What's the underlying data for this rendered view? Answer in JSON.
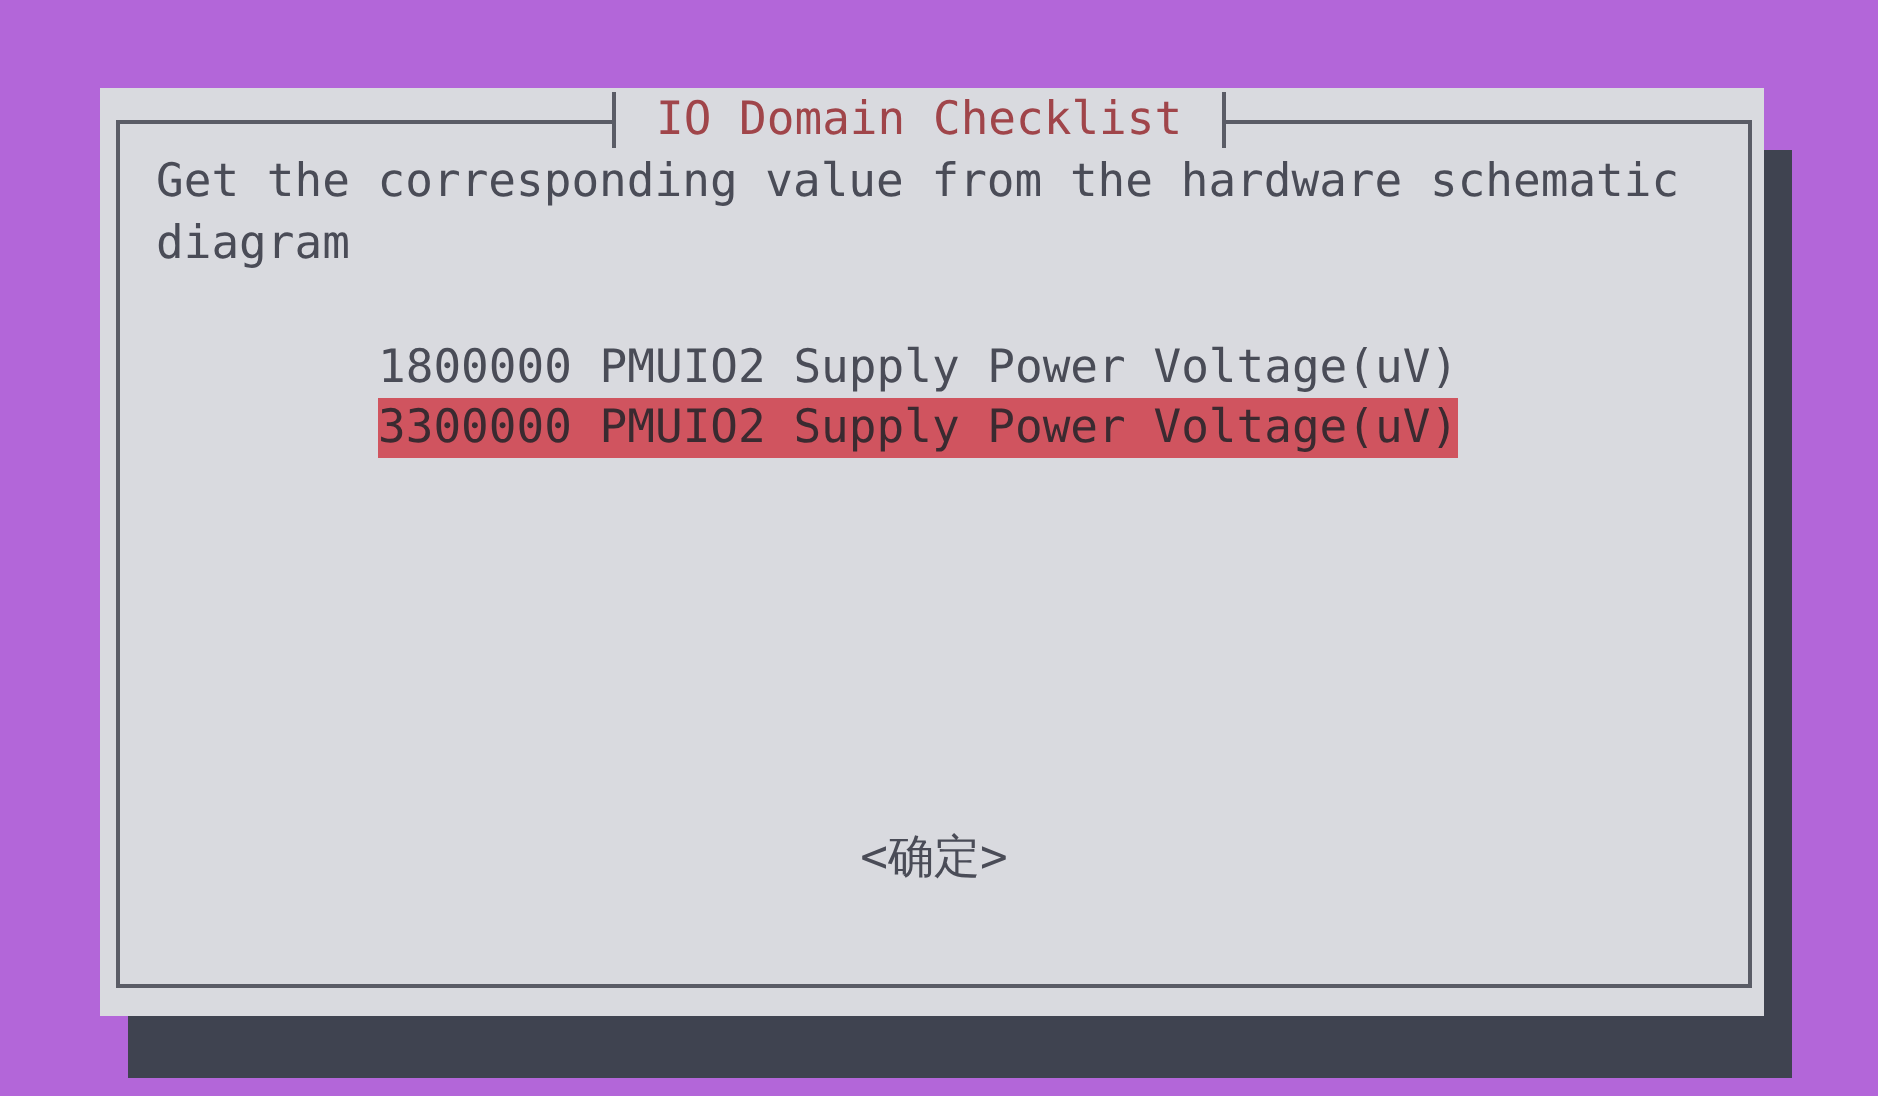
{
  "dialog": {
    "title": "IO Domain Checklist",
    "prompt": "Get the corresponding value from the hardware schematic diagram",
    "items": [
      {
        "label": "1800000 PMUIO2 Supply Power Voltage(uV)",
        "selected": false
      },
      {
        "label": "3300000 PMUIO2 Supply Power Voltage(uV)",
        "selected": true
      }
    ],
    "buttons": [
      "<确定>"
    ]
  }
}
